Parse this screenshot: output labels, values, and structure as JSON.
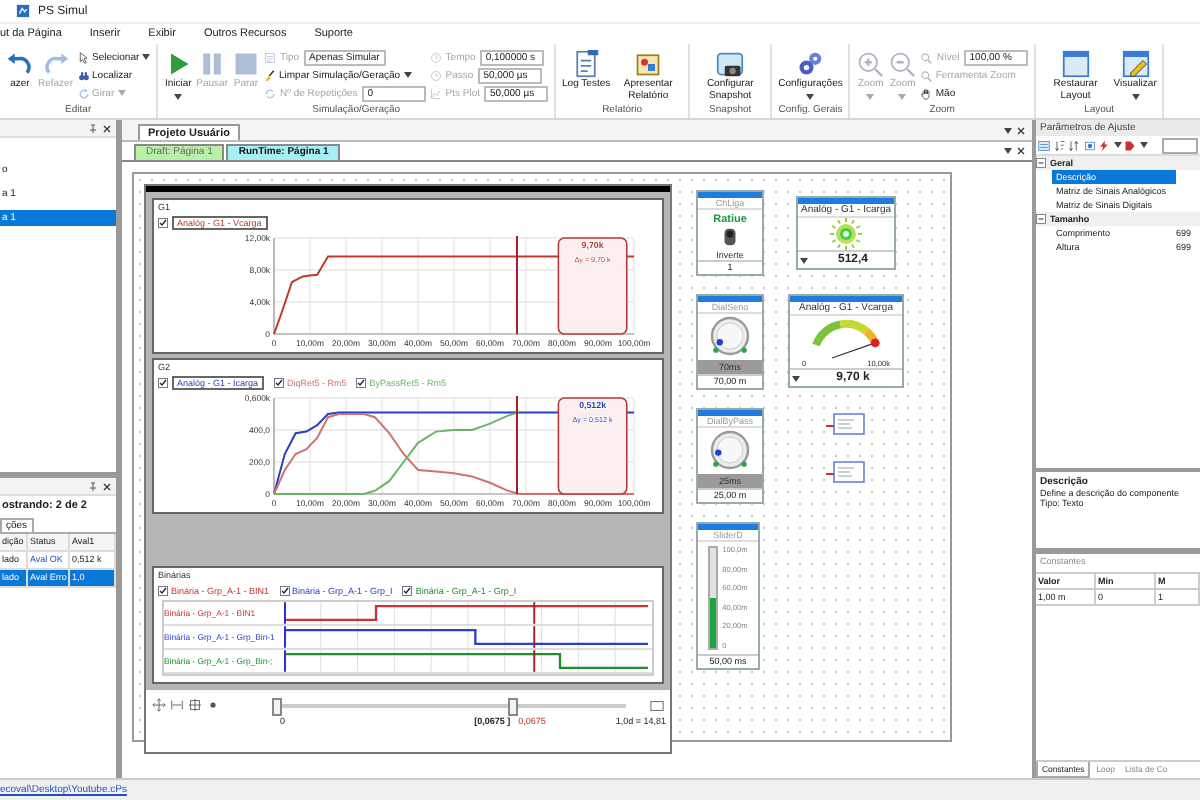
{
  "window": {
    "title": "PS Simul"
  },
  "menu": [
    "ut da Página",
    "Inserir",
    "Exibir",
    "Outros Recursos",
    "Suporte"
  ],
  "ribbon": [
    {
      "label": "Editar",
      "items": [
        {
          "kind": "large",
          "label": "azer",
          "disabled": false,
          "dropdown": false
        },
        {
          "kind": "large",
          "label": "Refazer",
          "disabled": true,
          "dropdown": false
        },
        {
          "kind": "small",
          "label": "Selecionar",
          "disabled": false,
          "dropdown": true
        },
        {
          "kind": "small",
          "label": "Localizar",
          "disabled": false,
          "dropdown": false
        },
        {
          "kind": "small",
          "label": "Girar",
          "disabled": true,
          "dropdown": true
        }
      ]
    },
    {
      "label": "Simulação/Geração",
      "items": [
        {
          "kind": "large",
          "label": "Iniciar",
          "disabled": false,
          "dropdown": true
        },
        {
          "kind": "large",
          "label": "Pausar",
          "disabled": true,
          "dropdown": false
        },
        {
          "kind": "large",
          "label": "Parar",
          "disabled": true,
          "dropdown": false
        },
        {
          "kind": "field",
          "label": "Tipo",
          "value": "Apenas Simular",
          "disabled": true
        },
        {
          "kind": "small",
          "label": "Limpar Simulação/Geração",
          "disabled": false,
          "dropdown": true
        },
        {
          "kind": "field",
          "label": "Nº de Repetições",
          "value": "0",
          "disabled": true
        },
        {
          "kind": "field",
          "label": "Tempo",
          "value": "0,100000 s",
          "disabled": true
        },
        {
          "kind": "field",
          "label": "Passo",
          "value": "50,000 µs",
          "disabled": true
        },
        {
          "kind": "field",
          "label": "Pts Plot",
          "value": "50,000 µs",
          "disabled": true
        }
      ]
    },
    {
      "label": "Relatório",
      "items": [
        {
          "kind": "large",
          "label": "Log Testes",
          "disabled": false,
          "dropdown": false
        },
        {
          "kind": "large",
          "label": "Apresentar Relatório",
          "disabled": false,
          "dropdown": false
        }
      ]
    },
    {
      "label": "Snapshot",
      "items": [
        {
          "kind": "large",
          "label": "Configurar Snapshot",
          "disabled": false,
          "dropdown": false
        }
      ]
    },
    {
      "label": "Config. Gerais",
      "items": [
        {
          "kind": "large",
          "label": "Configurações",
          "disabled": false,
          "dropdown": true
        }
      ]
    },
    {
      "label": "Zoom",
      "items": [
        {
          "kind": "large",
          "label": "Zoom",
          "disabled": true,
          "dropdown": true
        },
        {
          "kind": "large",
          "label": "Zoom",
          "disabled": true,
          "dropdown": true
        },
        {
          "kind": "field",
          "label": "Nível",
          "value": "100,00 %",
          "disabled": true
        },
        {
          "kind": "small",
          "label": "Ferramenta Zoom",
          "disabled": true,
          "dropdown": false
        },
        {
          "kind": "small",
          "label": "Mão",
          "disabled": false,
          "dropdown": false
        }
      ]
    },
    {
      "label": "Layout",
      "items": [
        {
          "kind": "large",
          "label": "Restaurar Layout",
          "disabled": false,
          "dropdown": false
        },
        {
          "kind": "large",
          "label": "Visualizar",
          "disabled": false,
          "dropdown": true
        }
      ]
    }
  ],
  "left": {
    "tree": [
      {
        "label": "o",
        "selected": false
      },
      {
        "label": "a 1",
        "selected": false
      },
      {
        "label": "a 1",
        "selected": true
      }
    ],
    "results": {
      "summary": "ostrando: 2 de 2",
      "tab": "ções",
      "columns": [
        "dição",
        "Status",
        "Aval1"
      ],
      "rows": [
        {
          "cells": [
            "lado",
            "Aval OK",
            "0,512 k"
          ],
          "selected": false
        },
        {
          "cells": [
            "lado",
            "Aval Erro",
            "1,0"
          ],
          "selected": true
        }
      ]
    }
  },
  "workspace": {
    "doc_tabs": [
      {
        "label": "Projeto Usuário",
        "selected": true
      }
    ],
    "page_tabs": [
      {
        "label": "Draft: Página 1",
        "selected": false
      },
      {
        "label": "RunTime: Página 1",
        "selected": true
      }
    ],
    "scope": {
      "graphs": [
        {
          "legend_checked": [
            true
          ],
          "chart_data": {
            "type": "line",
            "title": "G1",
            "x": [
              0,
              2,
              5,
              8,
              10,
              12,
              15,
              20,
              30,
              40,
              50,
              60,
              70,
              80,
              90,
              100
            ],
            "grid": true,
            "series": [
              {
                "name": "Analóg - G1 - Vcarga",
                "color": "#c0392b",
                "values": [
                  0,
                  2500,
                  6500,
                  7200,
                  7300,
                  7400,
                  9700,
                  9700,
                  9700,
                  9700,
                  9700,
                  9700,
                  9700,
                  9700,
                  9700,
                  9700
                ]
              }
            ],
            "xlim": [
              0,
              100
            ],
            "ylim": [
              0,
              12000
            ],
            "xticks": [
              {
                "value": 0,
                "label": "0"
              },
              {
                "value": 10,
                "label": "10,00m"
              },
              {
                "value": 20,
                "label": "20,00m"
              },
              {
                "value": 30,
                "label": "30,00m"
              },
              {
                "value": 40,
                "label": "40,00m"
              },
              {
                "value": 50,
                "label": "50,00m"
              },
              {
                "value": 60,
                "label": "60,00m"
              },
              {
                "value": 70,
                "label": "70,00m"
              },
              {
                "value": 80,
                "label": "80,00m"
              },
              {
                "value": 90,
                "label": "90,00m"
              },
              {
                "value": 100,
                "label": "100,00m"
              }
            ],
            "yticks": [
              {
                "value": 0,
                "label": "0"
              },
              {
                "value": 4000,
                "label": "4,00k"
              },
              {
                "value": 8000,
                "label": "8,00k"
              },
              {
                "value": 12000,
                "label": "12,00k"
              }
            ],
            "ref_lines": [
              {
                "axis": "x",
                "value": 67.5,
                "color": "#a02030"
              }
            ],
            "bands": [
              {
                "axis": "x",
                "from": 79,
                "to": 98
              }
            ],
            "annotations": [
              "9,70k",
              "Δy = 9,70 k"
            ]
          }
        },
        {
          "legend_checked": [
            true,
            true,
            true
          ],
          "chart_data": {
            "type": "line",
            "title": "G2",
            "x": [
              0,
              3,
              6,
              9,
              12,
              15,
              18,
              20,
              25,
              28,
              32,
              36,
              40,
              45,
              50,
              55,
              60,
              65,
              68,
              70,
              80,
              90,
              100
            ],
            "grid": true,
            "series": [
              {
                "name": "Analóg - G1 - Icarga",
                "color": "#2a3fbf",
                "values": [
                  0,
                  250,
                  380,
                  390,
                  430,
                  500,
                  510,
                  510,
                  510,
                  510,
                  510,
                  510,
                  510,
                  510,
                  510,
                  510,
                  510,
                  510,
                  510,
                  510,
                  510,
                  510,
                  510
                ]
              },
              {
                "name": "DiqRet5 - Rm5",
                "color": "#d27070",
                "values": [
                  0,
                  150,
                  250,
                  280,
                  350,
                  480,
                  500,
                  500,
                  500,
                  480,
                  380,
                  250,
                  150,
                  140,
                  130,
                  110,
                  70,
                  20,
                  0,
                  0,
                  0,
                  0,
                  0
                ]
              },
              {
                "name": "ByPassRet5 - Rm5",
                "color": "#6ab56a",
                "values": [
                  0,
                  0,
                  0,
                  0,
                  0,
                  0,
                  0,
                  0,
                  0,
                  20,
                  80,
                  200,
                  320,
                  390,
                  400,
                  400,
                  440,
                  490,
                  510,
                  null,
                  null,
                  null,
                  null
                ]
              }
            ],
            "xlim": [
              0,
              100
            ],
            "ylim": [
              0,
              600
            ],
            "xticks": [
              {
                "value": 0,
                "label": "0"
              },
              {
                "value": 10,
                "label": "10,00m"
              },
              {
                "value": 20,
                "label": "20,00m"
              },
              {
                "value": 30,
                "label": "30,00m"
              },
              {
                "value": 40,
                "label": "40,00m"
              },
              {
                "value": 50,
                "label": "50,00m"
              },
              {
                "value": 60,
                "label": "60,00m"
              },
              {
                "value": 70,
                "label": "70,00m"
              },
              {
                "value": 80,
                "label": "80,00m"
              },
              {
                "value": 90,
                "label": "90,00m"
              },
              {
                "value": 100,
                "label": "100,00m"
              }
            ],
            "yticks": [
              {
                "value": 0,
                "label": "0"
              },
              {
                "value": 200,
                "label": "200,0"
              },
              {
                "value": 400,
                "label": "400,0"
              },
              {
                "value": 600,
                "label": "0,600k"
              }
            ],
            "ref_lines": [
              {
                "axis": "x",
                "value": 67.5,
                "color": "#a02030"
              }
            ],
            "bands": [
              {
                "axis": "x",
                "from": 79,
                "to": 98
              }
            ],
            "annotations": [
              "0,512k",
              "Δy = 0,512 k"
            ]
          }
        }
      ],
      "binary": {
        "title": "Binárias",
        "signals": [
          {
            "legend": "Binária - Grp_A-1 - BIN1",
            "row_label": "Binária - Grp_A-1 - BIN1",
            "checked": true,
            "color": "#d03030"
          },
          {
            "legend": "Binária - Grp_A-1 - Grp_I",
            "row_label": "Binária - Grp_A-1 - Grp_Bin-1",
            "checked": true,
            "color": "#2a3fd0"
          },
          {
            "legend": "Binária - Grp_A-1 - Grp_I",
            "row_label": "Binária - Grp_A-1 - Grp_Bin-;",
            "checked": true,
            "color": "#1f8f2a"
          }
        ]
      },
      "timeline": {
        "start": "0",
        "cursor": "[0,0675 ]",
        "value": "0,0675",
        "scale": "1,0d = 14,81",
        "level": 0.675
      }
    },
    "widgets": [
      {
        "kind": "switch",
        "title": "ChLiga",
        "state": "Ratiue",
        "label": "Inverte",
        "value": "1"
      },
      {
        "kind": "led",
        "title": "Analóg - G1 - Icarga",
        "value": "512,4"
      },
      {
        "kind": "dial",
        "title": "DialSeno",
        "level": 0.05,
        "reading": "70ms",
        "value": "70,00 m"
      },
      {
        "kind": "meter",
        "title": "Analóg - G1 - Vcarga",
        "min": "0",
        "max": "10,00k",
        "level": 0.97,
        "value": "9,70 k"
      },
      {
        "kind": "dial",
        "title": "DialByPass",
        "level": 0.12,
        "reading": "25ms",
        "value": "25,00 m"
      },
      {
        "kind": "block"
      },
      {
        "kind": "slider",
        "title": "SliderD",
        "ticks": [
          "100,0m",
          "80,00m",
          "60,00m",
          "40,00m",
          "20,00m",
          "0"
        ],
        "level": 0.5,
        "value": "50,00 ms"
      },
      {
        "kind": "block"
      }
    ]
  },
  "right": {
    "title": "Parâmetros de Ajuste",
    "categories": [
      {
        "label": "Geral",
        "expanded": true,
        "properties": [
          {
            "name": "Descrição",
            "selected": true
          },
          {
            "name": "Matriz de Sinais Analógicos",
            "selected": false
          },
          {
            "name": "Matriz de Sinais Digitais",
            "selected": false
          }
        ]
      },
      {
        "label": "Tamanho",
        "expanded": true,
        "properties": [
          {
            "name": "Comprimento",
            "value": "699",
            "selected": false
          },
          {
            "name": "Altura",
            "value": "699",
            "selected": false
          }
        ]
      }
    ],
    "description": {
      "title": "Descrição",
      "text": "Define a descrição do componente",
      "type": "Tipo: Texto"
    },
    "constants": {
      "title": "Constantes",
      "columns": [
        "Valor",
        "Min",
        "M"
      ],
      "rows": [
        [
          "1,00 m",
          "0",
          "1"
        ]
      ]
    },
    "tabs": [
      {
        "label": "Constantes",
        "selected": true
      },
      {
        "label": "Loop",
        "selected": false
      },
      {
        "label": "Lista de Co",
        "selected": false
      }
    ]
  },
  "status_bar": {
    "path": "ecoval\\Desktop\\Youtube.cPs"
  }
}
